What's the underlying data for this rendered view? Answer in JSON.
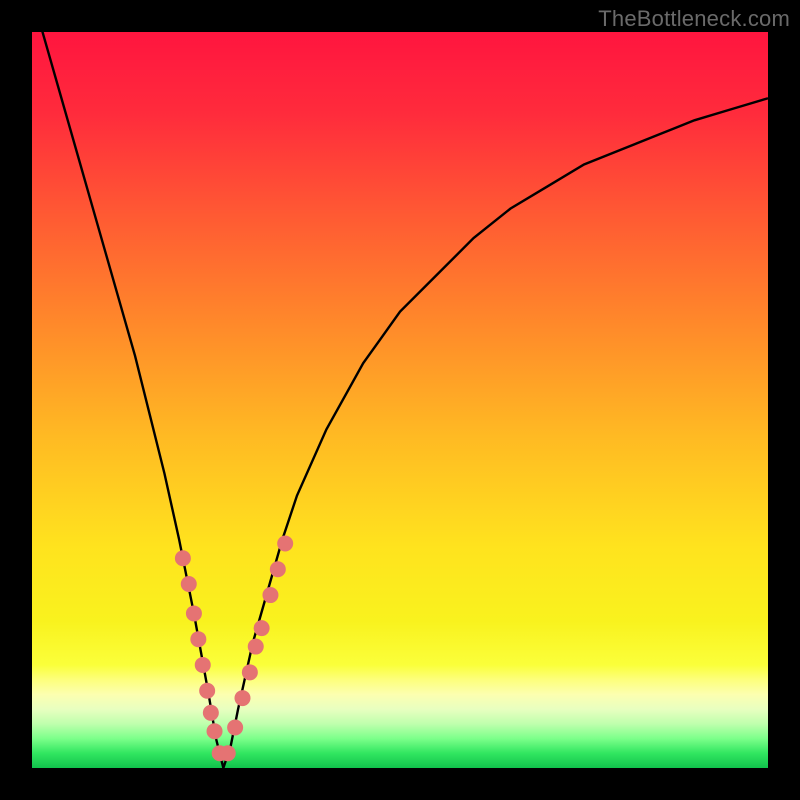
{
  "watermark": "TheBottleneck.com",
  "colors": {
    "frame": "#000000",
    "dot": "#e57373",
    "curve": "#000000"
  },
  "gradient_stops": [
    {
      "pct": 0,
      "color": "#ff153f"
    },
    {
      "pct": 11,
      "color": "#ff2b3c"
    },
    {
      "pct": 25,
      "color": "#ff5a33"
    },
    {
      "pct": 40,
      "color": "#ff8a2a"
    },
    {
      "pct": 55,
      "color": "#ffba23"
    },
    {
      "pct": 70,
      "color": "#ffe31e"
    },
    {
      "pct": 80,
      "color": "#f9f21e"
    },
    {
      "pct": 86,
      "color": "#faff3a"
    },
    {
      "pct": 88,
      "color": "#fdff7c"
    },
    {
      "pct": 90,
      "color": "#fcffb0"
    },
    {
      "pct": 92,
      "color": "#e8ffc0"
    },
    {
      "pct": 94,
      "color": "#bfffad"
    },
    {
      "pct": 96,
      "color": "#7cff8a"
    },
    {
      "pct": 98,
      "color": "#31e660"
    },
    {
      "pct": 100,
      "color": "#11c24c"
    }
  ],
  "chart_data": {
    "type": "line",
    "title": "",
    "xlabel": "",
    "ylabel": "",
    "xlim": [
      0,
      100
    ],
    "ylim": [
      0,
      100
    ],
    "x_optimum": 26,
    "series": [
      {
        "name": "bottleneck-curve",
        "x": [
          0,
          2,
          4,
          6,
          8,
          10,
          12,
          14,
          16,
          18,
          20,
          22,
          24,
          25,
          26,
          27,
          28,
          30,
          32,
          34,
          36,
          40,
          45,
          50,
          55,
          60,
          65,
          70,
          75,
          80,
          85,
          90,
          95,
          100
        ],
        "y": [
          105,
          98,
          91,
          84,
          77,
          70,
          63,
          56,
          48,
          40,
          31,
          21,
          10,
          4,
          0,
          3,
          8,
          17,
          24,
          31,
          37,
          46,
          55,
          62,
          67,
          72,
          76,
          79,
          82,
          84,
          86,
          88,
          89.5,
          91
        ]
      }
    ],
    "dots": {
      "name": "highlighted-points",
      "x": [
        20.5,
        21.3,
        22.0,
        22.6,
        23.2,
        23.8,
        24.3,
        24.8,
        25.5,
        26.6,
        27.6,
        28.6,
        29.6,
        30.4,
        31.2,
        32.4,
        33.4,
        34.4
      ],
      "y": [
        28.5,
        25.0,
        21.0,
        17.5,
        14.0,
        10.5,
        7.5,
        5.0,
        2.0,
        2.0,
        5.5,
        9.5,
        13.0,
        16.5,
        19.0,
        23.5,
        27.0,
        30.5
      ]
    }
  }
}
